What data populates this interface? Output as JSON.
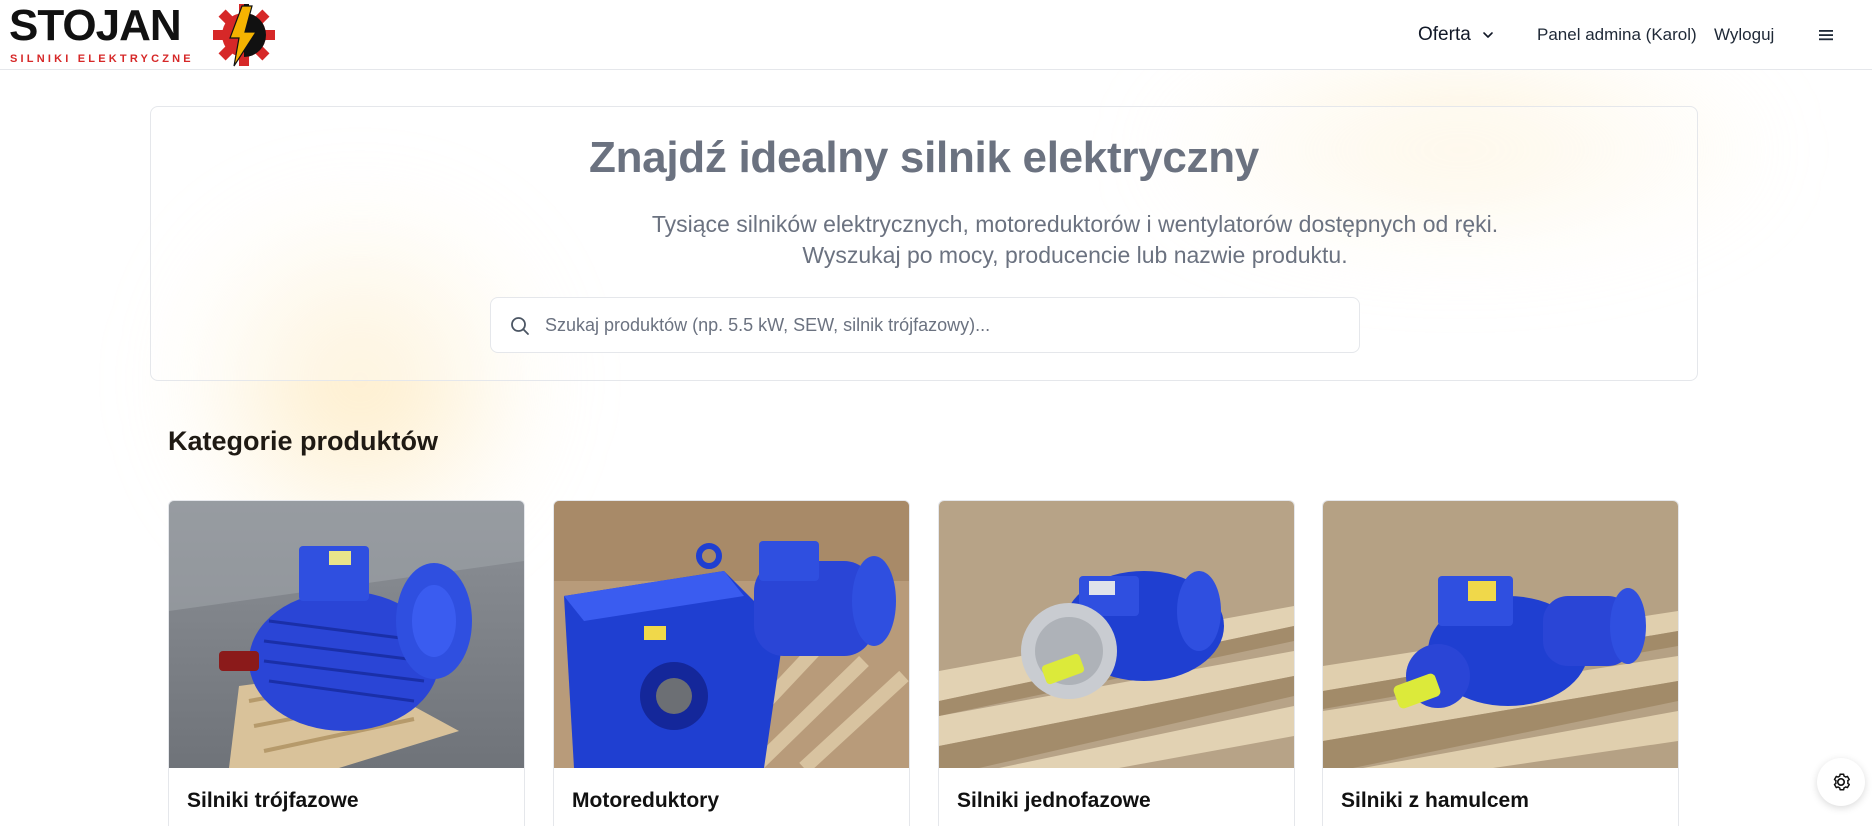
{
  "brand": {
    "name": "STOJAN",
    "tagline": "SILNIKI ELEKTRYCZNE",
    "colors": {
      "text": "#111111",
      "accent": "#d62828",
      "bolt": "#f5b301"
    }
  },
  "header": {
    "nav": {
      "offer_label": "Oferta",
      "admin_label": "Panel admina (Karol)",
      "logout_label": "Wyloguj"
    },
    "icons": {
      "offer_dropdown": "chevron-down-icon",
      "menu": "hamburger-menu-icon"
    }
  },
  "hero": {
    "title": "Znajdź idealny silnik elektryczny",
    "subtitle": "Tysiące silników elektrycznych, motoreduktorów i wentylatorów dostępnych od ręki. Wyszukaj po mocy, producencie lub nazwie produktu.",
    "search": {
      "value": "",
      "placeholder": "Szukaj produktów (np. 5.5 kW, SEW, silnik trójfazowy)...",
      "icon": "search-icon"
    }
  },
  "categories": {
    "heading": "Kategorie produktów",
    "items": [
      {
        "label": "Silniki trójfazowe",
        "image": "blue-three-phase-motor-photo"
      },
      {
        "label": "Motoreduktory",
        "image": "blue-gear-motor-photo"
      },
      {
        "label": "Silniki jednofazowe",
        "image": "blue-single-phase-motor-photo"
      },
      {
        "label": "Silniki z hamulcem",
        "image": "blue-brake-motor-photo"
      }
    ]
  },
  "floating": {
    "settings_icon": "gear-icon"
  },
  "colors": {
    "motor_blue": "#1f3fd1",
    "hero_text": "#6b7280",
    "border": "#e5e7eb"
  }
}
